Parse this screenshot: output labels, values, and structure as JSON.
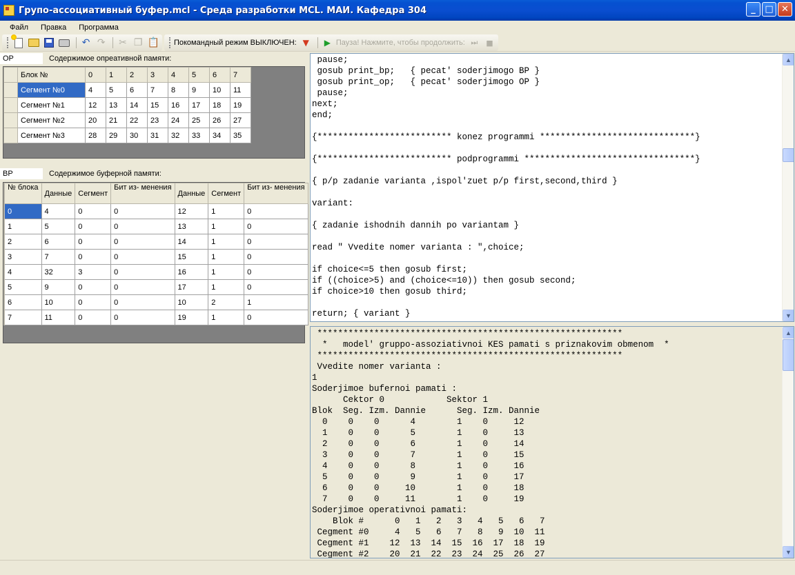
{
  "window": {
    "title": "Групо-ассоциативный буфер.mcl - Среда разработки MCL. МАИ. Кафедра 304",
    "minimize": "_",
    "maximize": "□",
    "close": "✕"
  },
  "menu": {
    "file": "Файл",
    "edit": "Правка",
    "program": "Программа"
  },
  "toolbar": {
    "icons": [
      "new-icon",
      "open-icon",
      "save-icon",
      "print-icon",
      "undo-icon",
      "redo-icon",
      "cut-icon",
      "copy-icon",
      "paste-icon"
    ],
    "step_mode_label": "Покомандный режим ВЫКЛЮЧЕН:",
    "pause_label": "Пауза! Нажмите, чтобы продолжить:"
  },
  "op": {
    "box_label": "OP",
    "caption": "Содержимое опреативной памяти:",
    "columns": [
      "Блок №",
      "0",
      "1",
      "2",
      "3",
      "4",
      "5",
      "6",
      "7"
    ],
    "rows": [
      [
        "Сегмент №0",
        "4",
        "5",
        "6",
        "7",
        "8",
        "9",
        "10",
        "11"
      ],
      [
        "Сегмент №1",
        "12",
        "13",
        "14",
        "15",
        "16",
        "17",
        "18",
        "19"
      ],
      [
        "Сегмент №2",
        "20",
        "21",
        "22",
        "23",
        "24",
        "25",
        "26",
        "27"
      ],
      [
        "Сегмент №3",
        "28",
        "29",
        "30",
        "31",
        "32",
        "33",
        "34",
        "35"
      ]
    ]
  },
  "bp": {
    "box_label": "BP",
    "caption": "Содержимое буферной памяти:",
    "columns": [
      "№ блока",
      "Данные",
      "Сегмент",
      "Бит из- менения",
      "Данные",
      "Сегмент",
      "Бит из- менения"
    ],
    "rows": [
      [
        "0",
        "4",
        "0",
        "0",
        "12",
        "1",
        "0"
      ],
      [
        "1",
        "5",
        "0",
        "0",
        "13",
        "1",
        "0"
      ],
      [
        "2",
        "6",
        "0",
        "0",
        "14",
        "1",
        "0"
      ],
      [
        "3",
        "7",
        "0",
        "0",
        "15",
        "1",
        "0"
      ],
      [
        "4",
        "32",
        "3",
        "0",
        "16",
        "1",
        "0"
      ],
      [
        "5",
        "9",
        "0",
        "0",
        "17",
        "1",
        "0"
      ],
      [
        "6",
        "10",
        "0",
        "0",
        "10",
        "2",
        "1"
      ],
      [
        "7",
        "11",
        "0",
        "0",
        "19",
        "1",
        "0"
      ]
    ]
  },
  "code_lines": [
    " pause;",
    " gosub print_bp;   { pecat' soderjimogo BP }",
    " gosub print_op;   { pecat' soderjimogo OP }",
    " pause;",
    "next;",
    "end;",
    "",
    "{************************** konez programmi ******************************}",
    "",
    "{************************** podprogrammi *********************************}",
    "",
    "{ p/p zadanie varianta ,ispol'zuet p/p first,second,third }",
    "",
    "variant:",
    "",
    "{ zadanie ishodnih dannih po variantam }",
    "",
    "read \" Vvedite nomer varianta : \",choice;",
    "",
    "if choice<=5 then gosub first;",
    "if ((choice>5) and (choice<=10)) then gosub second;",
    "if choice>10 then gosub third;",
    "",
    "return; { variant }"
  ],
  "output_lines": [
    " ***********************************************************",
    "  *   model' gruppo-assoziativnoi KES pamati s priznakovim obmenom  *",
    " ***********************************************************",
    " Vvedite nomer varianta :",
    "1",
    "Soderjimoe bufernoi pamati :",
    "      Cektor 0            Sektor 1",
    "Blok  Seg. Izm. Dannie      Seg. Izm. Dannie",
    "  0    0    0      4        1    0     12",
    "  1    0    0      5        1    0     13",
    "  2    0    0      6        1    0     14",
    "  3    0    0      7        1    0     15",
    "  4    0    0      8        1    0     16",
    "  5    0    0      9        1    0     17",
    "  6    0    0     10        1    0     18",
    "  7    0    0     11        1    0     19",
    "Soderjimoe operativnoi pamati:",
    "    Blok #      0   1   2   3   4   5   6   7",
    " Cegment #0     4   5   6   7   8   9  10  11",
    " Cegment #1    12  13  14  15  16  17  18  19",
    " Cegment #2    20  21  22  23  24  25  26  27"
  ]
}
